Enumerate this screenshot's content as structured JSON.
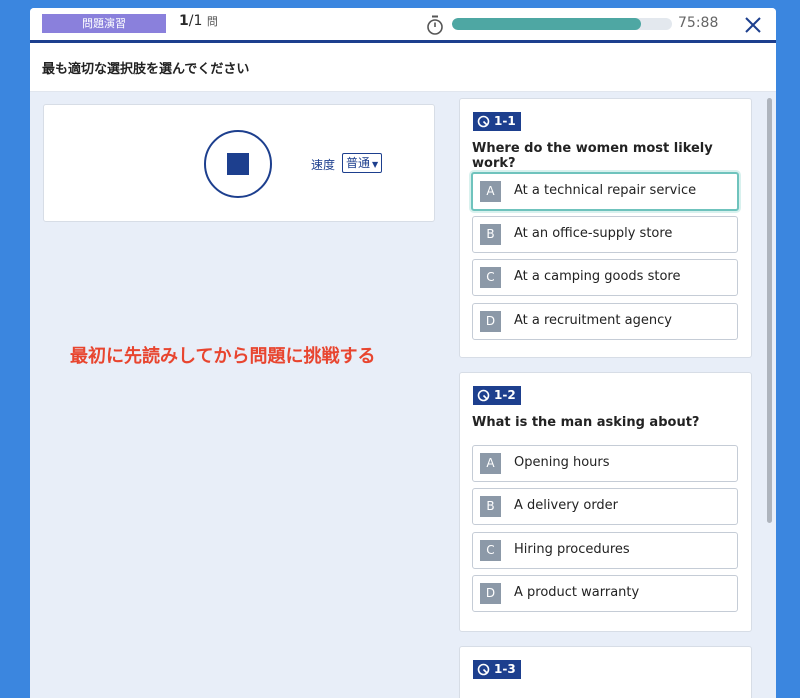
{
  "header": {
    "mode_badge": "問題演習",
    "counter_current": "1",
    "counter_total": "/1",
    "counter_unit": "問",
    "timer_progress": 0.86,
    "timer_text": "75:88"
  },
  "instruction": "最も適切な選択肢を選んでください",
  "player": {
    "speed_label": "速度",
    "speed_value": "普通"
  },
  "hint": "最初に先読みしてから問題に挑戦する",
  "questions": [
    {
      "number": "1-1",
      "text": "Where do the women most likely work?",
      "options": [
        {
          "letter": "A",
          "text": "At a technical repair service"
        },
        {
          "letter": "B",
          "text": "At an office-supply store"
        },
        {
          "letter": "C",
          "text": "At a camping goods store"
        },
        {
          "letter": "D",
          "text": "At a recruitment agency"
        }
      ]
    },
    {
      "number": "1-2",
      "text": "What is the man asking about?",
      "options": [
        {
          "letter": "A",
          "text": "Opening hours"
        },
        {
          "letter": "B",
          "text": "A delivery order"
        },
        {
          "letter": "C",
          "text": "Hiring procedures"
        },
        {
          "letter": "D",
          "text": "A product warranty"
        }
      ]
    },
    {
      "number": "1-3"
    }
  ],
  "colors": {
    "background": "#3b86df",
    "accent": "#1d3f8e",
    "badge": "#8a80dc",
    "progress": "#4ea7a3",
    "hint": "#e8452f",
    "selected_border": "#6fc3bd"
  }
}
